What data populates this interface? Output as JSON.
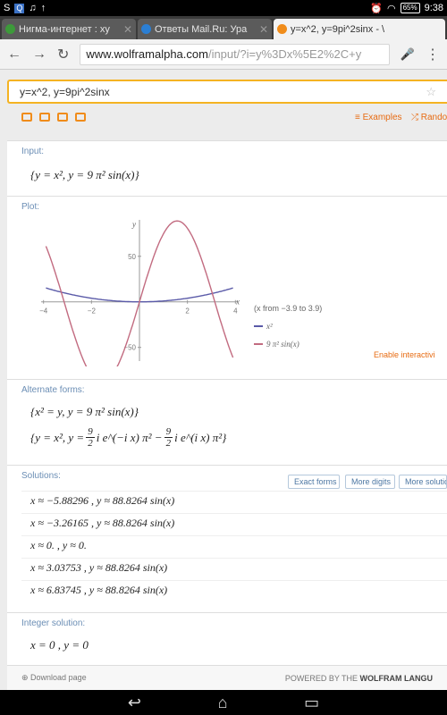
{
  "status_bar": {
    "left_icons": [
      "S",
      "Q",
      "♫",
      "↑"
    ],
    "battery": "65%",
    "time": "9:38"
  },
  "tabs": [
    {
      "title": "Нигма-интернет : ху",
      "favicon_color": "#3d9a3a",
      "active": false
    },
    {
      "title": "Ответы Mail.Ru: Ура",
      "favicon_color": "#2b7fd4",
      "active": false
    },
    {
      "title": "y=x^2, y=9pi^2sinx - \\",
      "favicon_color": "#f08c1a",
      "active": true
    }
  ],
  "toolbar": {
    "back": "←",
    "forward": "→",
    "reload": "↻",
    "url_host": "www.wolframalpha.com",
    "url_path": "/input/?i=y%3Dx%5E2%2C+y",
    "mic": "🎤",
    "menu": "⋮"
  },
  "search": {
    "query": "y=x^2, y=9pi^2sinx",
    "star": "☆"
  },
  "links": {
    "examples": "≡ Examples",
    "random": "⤮ Rando"
  },
  "input_pod": {
    "title": "Input:",
    "expr": "{y = x², y = 9 π² sin(x)}"
  },
  "plot_pod": {
    "title": "Plot:",
    "range_note": "(x from −3.9 to 3.9)",
    "legend": [
      {
        "label": "x²",
        "color": "#5a5aa8"
      },
      {
        "label": "9 π² sin(x)",
        "color": "#c26b80"
      }
    ],
    "enable_interactive": "Enable interactivi"
  },
  "chart_data": {
    "type": "line",
    "title": "",
    "xlabel": "x",
    "ylabel": "y",
    "xlim": [
      -4.1,
      4.1
    ],
    "ylim": [
      -65,
      90
    ],
    "x_ticks": [
      -4,
      -2,
      2,
      4
    ],
    "y_ticks": [
      50,
      -50
    ],
    "series": [
      {
        "name": "x²",
        "function": "x^2",
        "domain": [
          -3.9,
          3.9
        ],
        "color": "#5a5aa8"
      },
      {
        "name": "9 π² sin(x)",
        "function": "9*pi^2*sin(x)",
        "domain": [
          -3.9,
          3.9
        ],
        "color": "#c26b80"
      }
    ]
  },
  "alt_pod": {
    "title": "Alternate forms:",
    "line1": "{x² = y, y = 9 π² sin(x)}",
    "line2_prefix": "{y = x², y =",
    "frac_num": "9",
    "frac_den": "2",
    "term1": "i e^(−i x) π² −",
    "term2": "i e^(i x) π²}"
  },
  "solutions_pod": {
    "title": "Solutions:",
    "buttons": [
      "Exact forms",
      "More digits",
      "More solutio"
    ],
    "rows": [
      "x ≈ −5.88296 ,    y ≈ 88.8264 sin(x)",
      "x ≈ −3.26165 ,    y ≈ 88.8264 sin(x)",
      "x ≈ 0. ,    y ≈ 0.",
      "x ≈ 3.03753 ,    y ≈ 88.8264 sin(x)",
      "x ≈ 6.83745 ,    y ≈ 88.8264 sin(x)"
    ]
  },
  "integer_pod": {
    "title": "Integer solution:",
    "expr": "x = 0 ,    y = 0"
  },
  "footer": {
    "download": "⊕ Download page",
    "powered_prefix": "POWERED BY THE ",
    "powered_brand": "WOLFRAM LANGU"
  },
  "navbar": {
    "back": "⌂",
    "home": "⌂",
    "recents": "▭"
  }
}
